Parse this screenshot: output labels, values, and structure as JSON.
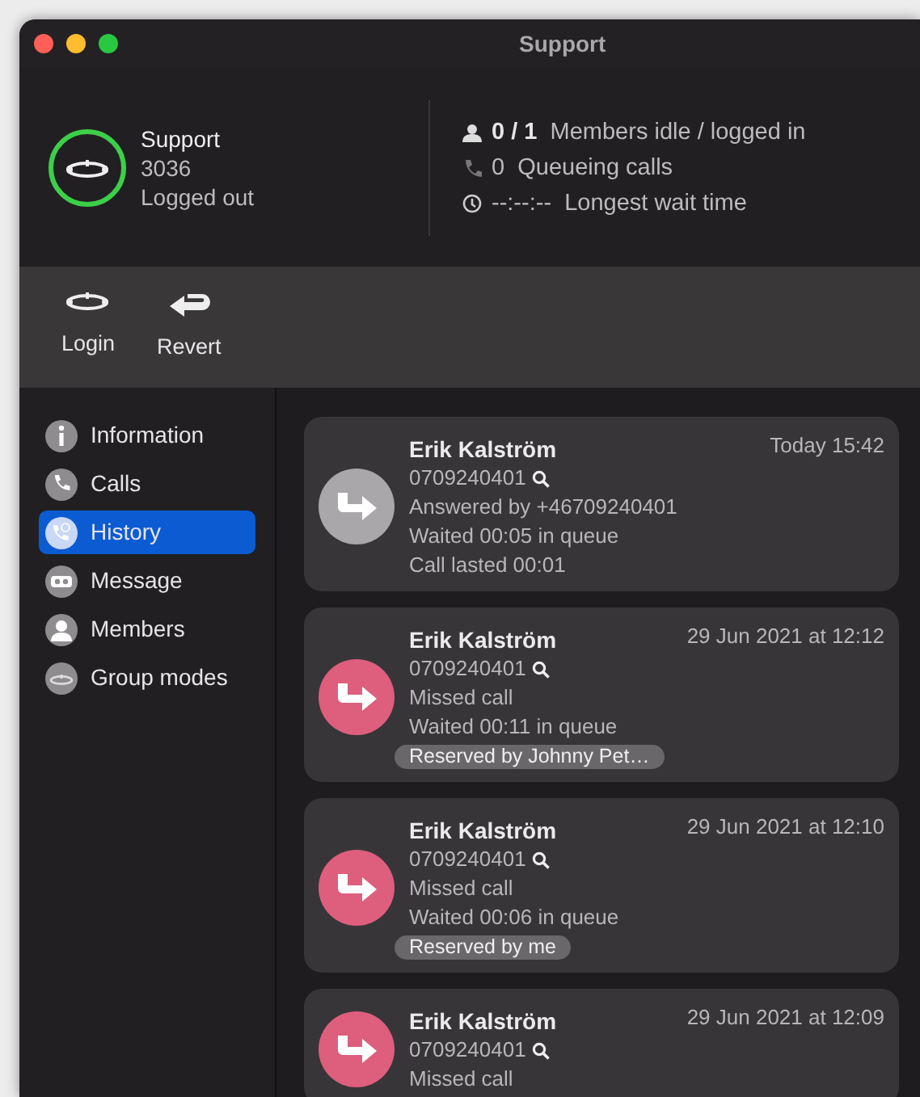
{
  "window": {
    "title": "Support"
  },
  "group": {
    "name": "Support",
    "number": "3036",
    "status": "Logged out"
  },
  "stats": [
    {
      "kind": "members",
      "text": "**0 / 1**  Members idle / logged in"
    },
    {
      "kind": "queue",
      "text": "0  Queueing calls"
    },
    {
      "kind": "wait",
      "text": "--:--:--  Longest wait time"
    }
  ],
  "toolbar": [
    {
      "kind": "login",
      "label": "Login"
    },
    {
      "kind": "revert",
      "label": "Revert"
    }
  ],
  "sidebar": {
    "items": [
      {
        "kind": "info",
        "label": "Information",
        "selected": false
      },
      {
        "kind": "calls",
        "label": "Calls",
        "selected": false
      },
      {
        "kind": "history",
        "label": "History",
        "selected": true
      },
      {
        "kind": "message",
        "label": "Message",
        "selected": false
      },
      {
        "kind": "members",
        "label": "Members",
        "selected": false
      },
      {
        "kind": "modes",
        "label": "Group modes",
        "selected": false
      }
    ]
  },
  "history": [
    {
      "kind": "answered",
      "name": "Erik Kalström",
      "time": "Today 15:42",
      "number": "0709240401",
      "lines": [
        "Answered by +46709240401",
        "Waited 00:05 in queue",
        "Call lasted 00:01"
      ]
    },
    {
      "kind": "missed",
      "name": "Erik Kalström",
      "time": "29 Jun 2021 at 12:12",
      "number": "0709240401",
      "lines": [
        "Missed call",
        "Waited 00:11 in queue"
      ],
      "tag": "Reserved by Johnny Pet…"
    },
    {
      "kind": "missed",
      "name": "Erik Kalström",
      "time": "29 Jun 2021 at 12:10",
      "number": "0709240401",
      "lines": [
        "Missed call",
        "Waited 00:06 in queue"
      ],
      "tag": "Reserved by me"
    },
    {
      "kind": "missed",
      "name": "Erik Kalström",
      "time": "29 Jun 2021 at 12:09",
      "number": "0709240401",
      "lines": [
        "Missed call"
      ]
    }
  ]
}
